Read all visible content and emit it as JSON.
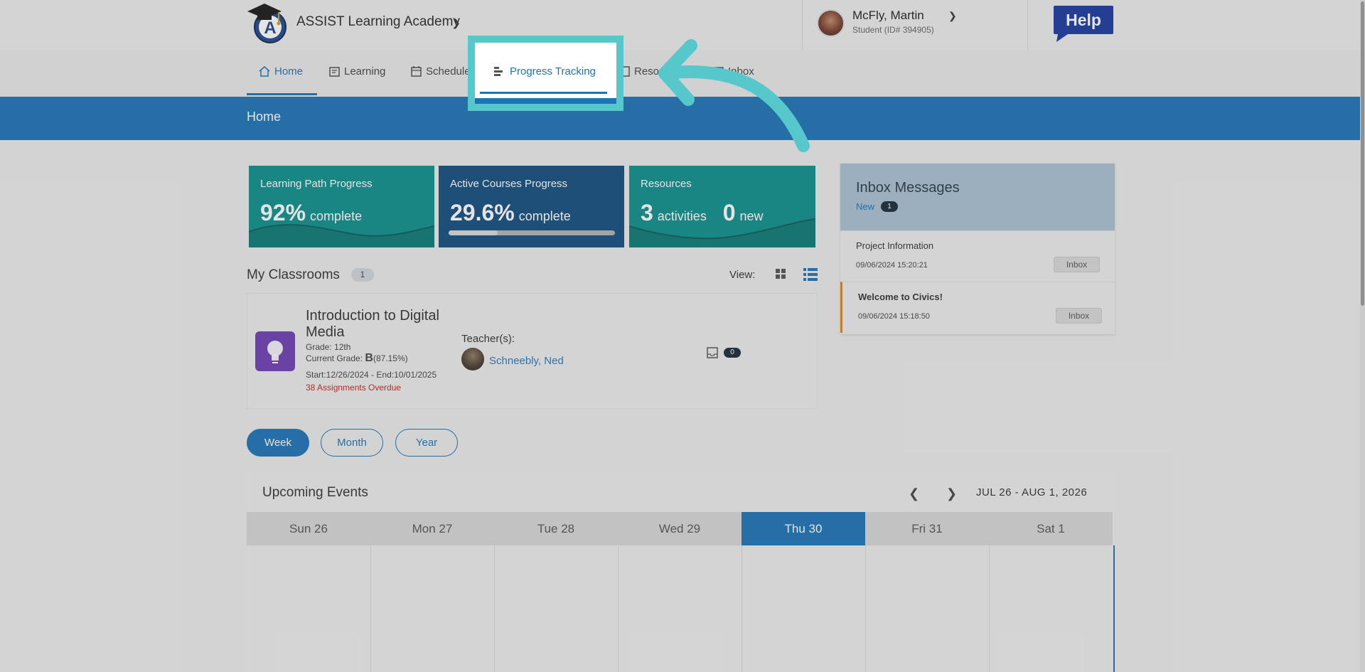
{
  "header": {
    "school_name": "ASSIST Learning Academy",
    "user_name": "McFly, Martin",
    "user_sub": "Student (ID# 394905)",
    "help_label": "Help"
  },
  "nav": {
    "items": [
      {
        "label": "Home",
        "icon": "home-icon",
        "active": true
      },
      {
        "label": "Learning",
        "icon": "learning-icon"
      },
      {
        "label": "Schedule",
        "icon": "calendar-icon"
      },
      {
        "label": "Progress Tracking",
        "icon": "progress-icon"
      },
      {
        "label": "Resources",
        "icon": "resources-icon"
      },
      {
        "label": "Inbox",
        "icon": "inbox-icon"
      }
    ]
  },
  "banner": {
    "title": "Home"
  },
  "cards": {
    "learning_path": {
      "title": "Learning Path Progress",
      "value": "92%",
      "unit": "complete"
    },
    "active_courses": {
      "title": "Active Courses Progress",
      "value": "29.6%",
      "unit": "complete",
      "progress": 0.296
    },
    "resources": {
      "title": "Resources",
      "activities": "3",
      "activities_unit": "activities",
      "new": "0",
      "new_unit": "new"
    }
  },
  "classrooms": {
    "title": "My Classrooms",
    "count": "1",
    "view_label": "View:",
    "items": [
      {
        "name": "Introduction to Digital Media",
        "grade": "Grade: 12th",
        "current_grade_label": "Current Grade:",
        "current_grade_letter": "B",
        "current_grade_pct": "(87.15%)",
        "dates": "Start:12/26/2024 - End:10/01/2025",
        "overdue": "38 Assignments Overdue",
        "teacher_label": "Teacher(s):",
        "teacher_name": "Schneebly, Ned",
        "inbox_count": "0"
      }
    ]
  },
  "inbox": {
    "title": "Inbox Messages",
    "new_label": "New",
    "new_count": "1",
    "messages": [
      {
        "title": "Project Information",
        "date": "09/06/2024 15:20:21",
        "button": "Inbox"
      },
      {
        "title": "Welcome to Civics!",
        "date": "09/06/2024 15:18:50",
        "button": "Inbox"
      }
    ]
  },
  "range_buttons": {
    "week": "Week",
    "month": "Month",
    "year": "Year"
  },
  "events": {
    "title": "Upcoming Events",
    "range": "JUL 26 - AUG 1, 2026",
    "days": [
      "Sun 26",
      "Mon 27",
      "Tue 28",
      "Wed 29",
      "Thu 30",
      "Fri 31",
      "Sat 1"
    ],
    "today_index": 4
  },
  "colors": {
    "primary": "#1d74b5",
    "highlight": "#56c8cc",
    "teal_card": "#0f8f8c",
    "navy_card": "#144e7f",
    "overdue": "#cc2222"
  }
}
